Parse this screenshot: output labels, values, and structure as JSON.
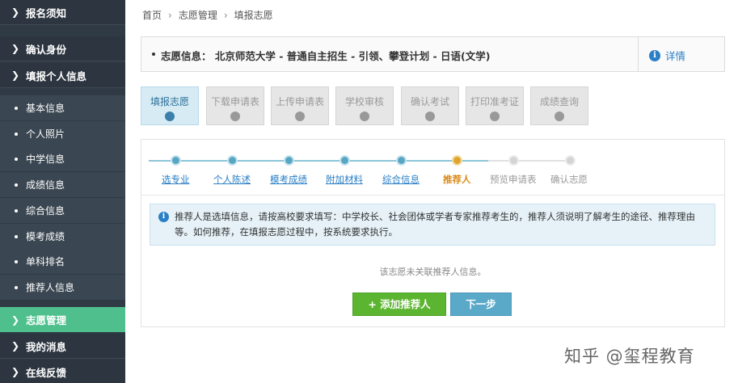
{
  "sidebar": {
    "sections": [
      {
        "label": "报名须知"
      },
      {
        "label": "确认身份"
      },
      {
        "label": "填报个人信息"
      }
    ],
    "sub_items": [
      {
        "label": "基本信息"
      },
      {
        "label": "个人照片"
      },
      {
        "label": "中学信息"
      },
      {
        "label": "成绩信息"
      },
      {
        "label": "综合信息"
      },
      {
        "label": "模考成绩"
      },
      {
        "label": "单科排名"
      },
      {
        "label": "推荐人信息"
      }
    ],
    "bottom_sections": [
      {
        "label": "志愿管理",
        "active": true
      },
      {
        "label": "我的消息"
      },
      {
        "label": "在线反馈"
      }
    ],
    "colors": {
      "bg": "#2f3a45",
      "active": "#4fc08d"
    }
  },
  "breadcrumb": {
    "items": [
      "首页",
      "志愿管理",
      "填报志愿"
    ]
  },
  "info": {
    "text": "志愿信息： 北京师范大学 - 普通自主招生 - 引领、攀登计划 - 日语(文学)",
    "detail_label": "详情"
  },
  "step_tabs": [
    {
      "label": "填报志愿",
      "active": true
    },
    {
      "label": "下载申请表"
    },
    {
      "label": "上传申请表"
    },
    {
      "label": "学校审核"
    },
    {
      "label": "确认考试"
    },
    {
      "label": "打印准考证"
    },
    {
      "label": "成绩查询"
    }
  ],
  "progress": {
    "steps": [
      {
        "label": "选专业",
        "state": "done"
      },
      {
        "label": "个人陈述",
        "state": "done"
      },
      {
        "label": "模考成绩",
        "state": "done"
      },
      {
        "label": "附加材料",
        "state": "done"
      },
      {
        "label": "综合信息",
        "state": "done"
      },
      {
        "label": "推荐人",
        "state": "current"
      },
      {
        "label": "预览申请表",
        "state": "todo"
      },
      {
        "label": "确认志愿",
        "state": "todo"
      }
    ]
  },
  "notice": {
    "text": "推荐人是选填信息，请按高校要求填写：中学校长、社会团体或学者专家推荐考生的，推荐人须说明了解考生的途径、推荐理由等。如何推荐，在填报志愿过程中，按系统要求执行。"
  },
  "empty_message": "该志愿未关联推荐人信息。",
  "buttons": {
    "add_label": "+ 添加推荐人",
    "next_label": "下一步"
  },
  "watermark": "知乎 @玺程教育"
}
